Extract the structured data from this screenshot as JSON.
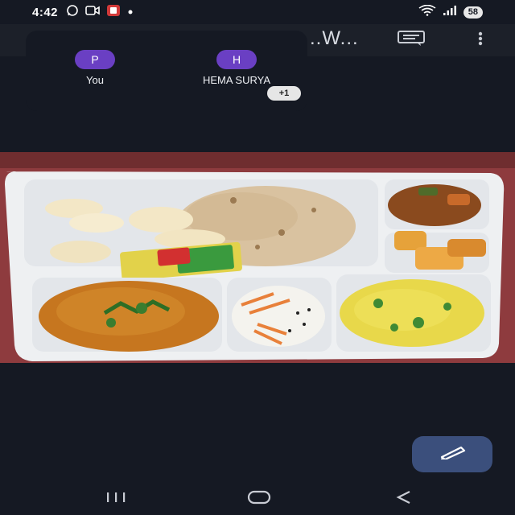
{
  "status_bar": {
    "time": "4:42",
    "battery": "58",
    "icons": [
      "whatsapp-icon",
      "video-icon",
      "notification-app-icon",
      "dot-icon",
      "wifi-icon",
      "signal-icon"
    ]
  },
  "app_bar": {
    "title": "..W...",
    "buttons": [
      "comment-icon",
      "more-vert-icon"
    ]
  },
  "participants": {
    "items": [
      {
        "initial": "P",
        "name": "You"
      },
      {
        "initial": "H",
        "name": "HEMA SURYA"
      }
    ],
    "more_count": "+1"
  },
  "photo": {
    "subject": "food-tray-photo"
  },
  "fab": {
    "icon": "pencil-icon"
  },
  "nav_bar": {
    "buttons": [
      "recents-icon",
      "home-icon",
      "back-icon"
    ]
  },
  "colors": {
    "background": "#151923",
    "avatar": "#6a3fc3",
    "fab": "#3b4f7c"
  }
}
